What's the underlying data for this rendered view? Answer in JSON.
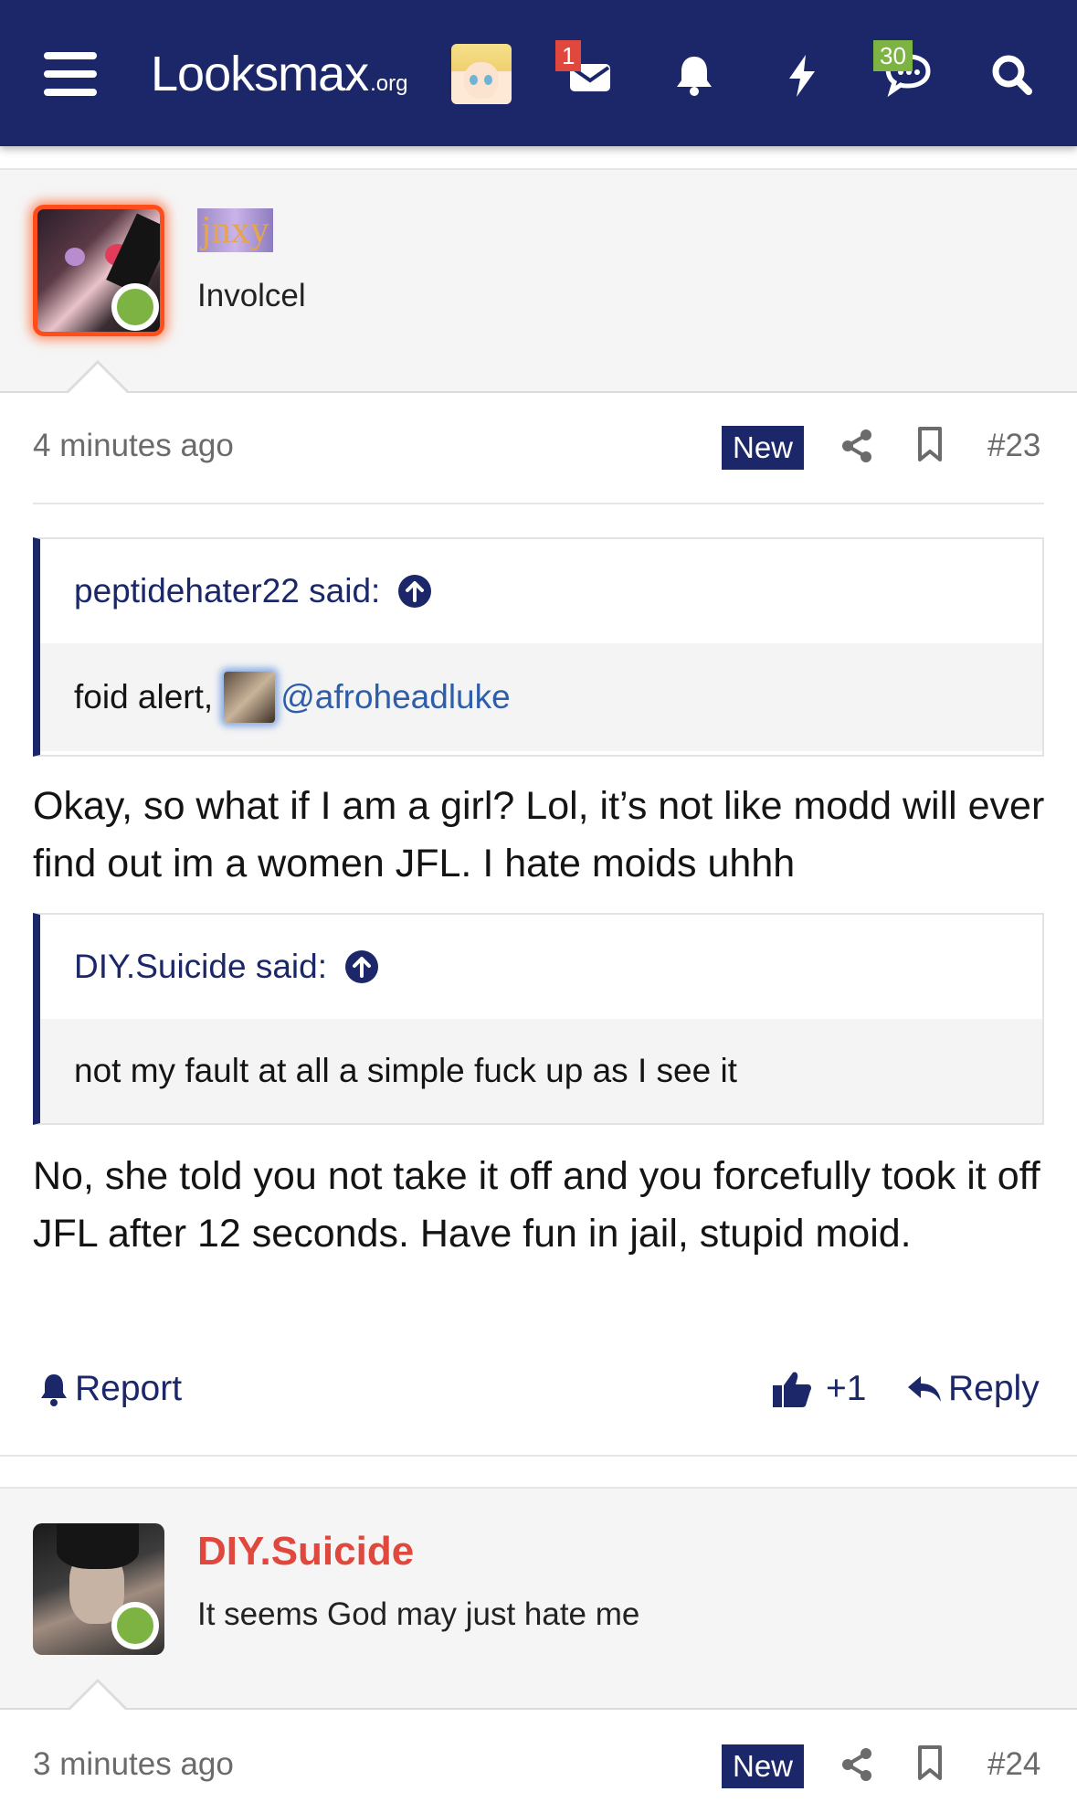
{
  "header": {
    "logo_main": "Looksmax",
    "logo_suffix": ".org",
    "inbox_badge": "1",
    "alerts_badge": "30"
  },
  "posts": [
    {
      "username": "jnxy",
      "user_title": "Involcel",
      "time": "4 minutes ago",
      "new_label": "New",
      "post_number": "#23",
      "quotes": [
        {
          "author_said": "peptidehater22 said:",
          "text": "foid alert,",
          "mention": "@afroheadluke"
        },
        {
          "author_said": "DIY.Suicide said:",
          "text": "not my fault at all a simple fuck up as I see it"
        }
      ],
      "reply_1": "Okay, so what if I am a girl? Lol, it’s not like modd will ever find out im a women JFL. I hate moids uhhh",
      "reply_2": "No, she told you not take it off and you forcefully took it off JFL after 12 seconds. Have fun in jail, stupid moid.",
      "report_label": "Report",
      "reaction_count": "+1",
      "reply_label": "Reply"
    },
    {
      "username": "DIY.Suicide",
      "user_title": "It seems God may just hate me",
      "time": "3 minutes ago",
      "new_label": "New",
      "post_number": "#24"
    }
  ],
  "colors": {
    "header_bg": "#1b2769",
    "accent": "#1b2769",
    "online": "#7cb342",
    "badge": "#e0483e",
    "username_red": "#e0483e"
  },
  "icons": [
    "menu-icon",
    "inbox-icon",
    "bell-icon",
    "bolt-icon",
    "chat-icon",
    "search-icon",
    "share-icon",
    "bookmark-icon",
    "arrow-up-circle-icon",
    "report-bell-icon",
    "thumbs-up-icon",
    "reply-icon"
  ]
}
